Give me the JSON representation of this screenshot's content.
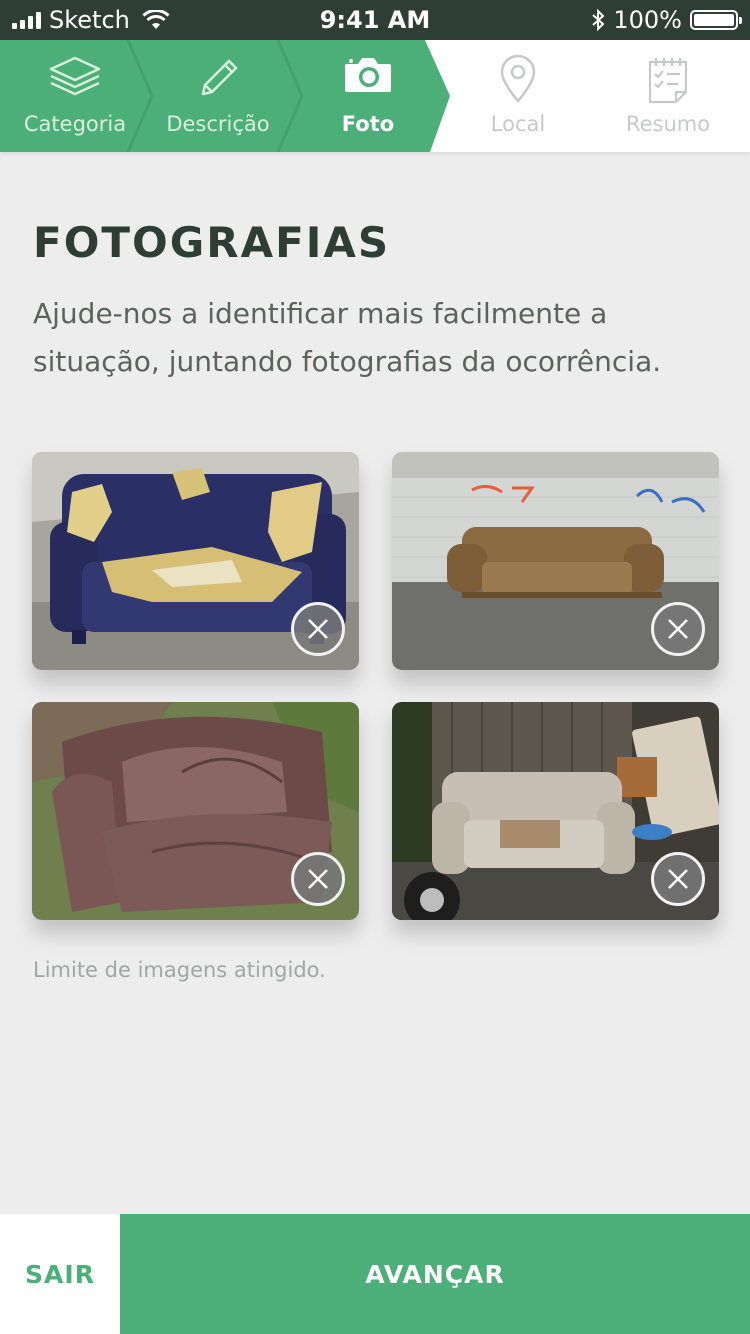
{
  "status_bar": {
    "carrier": "Sketch",
    "time": "9:41 AM",
    "battery": "100%",
    "icons": [
      "signal-icon",
      "wifi-icon",
      "bluetooth-icon",
      "battery-icon"
    ]
  },
  "stepper": {
    "steps": [
      {
        "label": "Categoria",
        "icon": "layers-icon",
        "state": "done"
      },
      {
        "label": "Descrição",
        "icon": "pencil-icon",
        "state": "done"
      },
      {
        "label": "Foto",
        "icon": "camera-icon",
        "state": "active"
      },
      {
        "label": "Local",
        "icon": "location-pin-icon",
        "state": "todo"
      },
      {
        "label": "Resumo",
        "icon": "checklist-icon",
        "state": "todo"
      }
    ]
  },
  "main": {
    "title": "FOTOGRAFIAS",
    "description": "Ajude-nos a identificar mais facilmente a situação, juntando fotografias da ocorrência.",
    "photos": [
      {
        "subject": "torn blue sofa",
        "remove_icon": "close-icon"
      },
      {
        "subject": "brown sofa by graffiti wall",
        "remove_icon": "close-icon"
      },
      {
        "subject": "leather sofa on grass",
        "remove_icon": "close-icon"
      },
      {
        "subject": "white sofa by fence",
        "remove_icon": "close-icon"
      }
    ],
    "limit_message": "Limite de imagens atingido."
  },
  "actions": {
    "exit_label": "SAIR",
    "next_label": "AVANÇAR"
  },
  "colors": {
    "accent": "#4caf77",
    "status_bar": "#2f3e35",
    "title": "#2f3e35",
    "background": "#ededed"
  }
}
